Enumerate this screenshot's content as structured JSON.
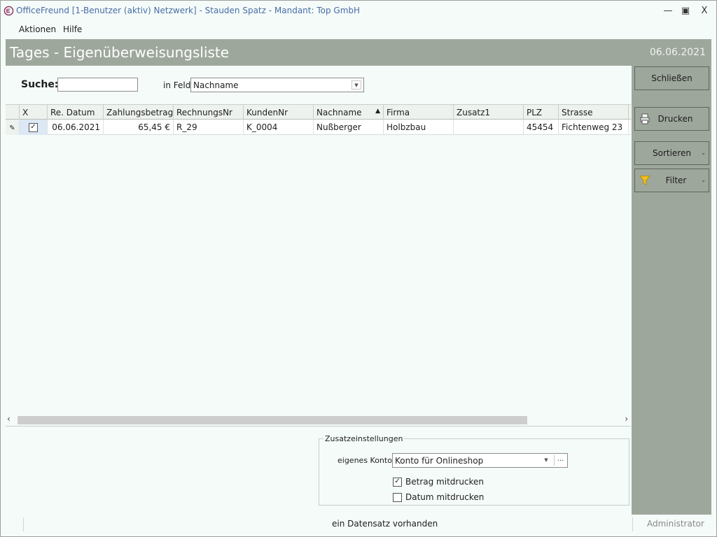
{
  "window": {
    "title": "OfficeFreund [1-Benutzer (aktiv) Netzwerk]  -  Stauden Spatz  -  Mandant: Top GmbH",
    "minimize": "🗕",
    "maximize": "🗖",
    "close": "X"
  },
  "menu": {
    "items": [
      {
        "label": "Aktionen"
      },
      {
        "label": "Hilfe"
      }
    ]
  },
  "header": {
    "title": "Tages - Eigenüberweisungsliste",
    "date": "06.06.2021"
  },
  "search": {
    "label": "Suche:",
    "value": "",
    "field_label": "in Feld:",
    "field_value": "Nachname"
  },
  "grid": {
    "columns": [
      "X",
      "Re. Datum",
      "Zahlungsbetrag",
      "RechnungsNr",
      "KundenNr",
      "Nachname",
      "Firma",
      "Zusatz1",
      "PLZ",
      "Strasse"
    ],
    "sorted_column": "Nachname",
    "rows": [
      {
        "checked": true,
        "datum": "06.06.2021",
        "betrag": "65,45 €",
        "rechnungsnr": "R_29",
        "kundennr": "K_0004",
        "nachname": "Nußberger",
        "firma": "Holbzbau",
        "zusatz1": "",
        "plz": "45454",
        "strasse": "Fichtenweg 23"
      }
    ]
  },
  "sidebar": {
    "close_label": "Schließen",
    "print_label": "Drucken",
    "sort_label": "Sortieren",
    "filter_label": "Filter"
  },
  "extra": {
    "group_title": "Zusatzeinstellungen",
    "konto_label": "eigenes Konto:",
    "konto_value": "Konto für Onlineshop",
    "konto_dots": "...",
    "betrag_label": "Betrag mitdrucken",
    "betrag_checked": true,
    "datum_label": "Datum mitdrucken",
    "datum_checked": false
  },
  "status": {
    "text": "ein Datensatz vorhanden",
    "user": "Administrator"
  },
  "colors": {
    "accent_gray": "#9ea79c",
    "title_blue": "#4a6da7"
  }
}
